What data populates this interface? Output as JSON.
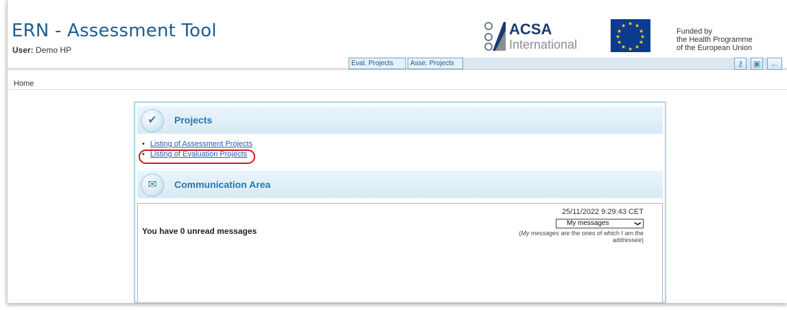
{
  "header": {
    "title": "ERN - Assessment Tool",
    "user_label": "User:",
    "user_name": "Demo HP"
  },
  "logos": {
    "acsa_name": "ACSA",
    "acsa_sub": "International",
    "funded_line1": "Funded by",
    "funded_line2": "the Health Programme",
    "funded_line3": "of the European Union"
  },
  "nav": {
    "buttons": [
      "Eval. Projects",
      "Asse. Projects"
    ],
    "icons": [
      "key-icon",
      "lock-icon",
      "back-arrow-icon"
    ]
  },
  "breadcrumb": {
    "home": "Home"
  },
  "projects": {
    "title": "Projects",
    "links": [
      "Listing of Assessment Projects",
      "Listing of Evaluation Projects"
    ]
  },
  "communication": {
    "title": "Communication Area",
    "timestamp": "25/11/2022 9:29:43 CET",
    "unread": "You have 0 unread messages",
    "filter_selected": "My messages",
    "note_emph": "My messages",
    "note_rest": "are the ones of which I am the addressee"
  },
  "colors": {
    "accent": "#2677b0",
    "highlight": "#d0171c",
    "panel_border": "#a9d3e6"
  }
}
